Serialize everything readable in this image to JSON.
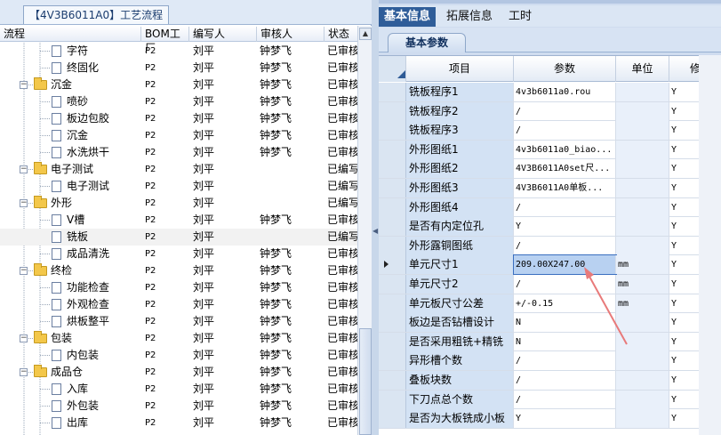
{
  "left_title": "【4V3B6011A0】工艺流程",
  "tree_columns": [
    "流程",
    "BOM工厂",
    "编写人",
    "审核人",
    "状态"
  ],
  "tree_rows": [
    {
      "level": 2,
      "type": "doc",
      "name": "字符",
      "bom": "P2",
      "writer": "刘平",
      "reviewer": "钟梦飞",
      "status": "已审核"
    },
    {
      "level": 2,
      "type": "doc",
      "name": "终固化",
      "bom": "P2",
      "writer": "刘平",
      "reviewer": "钟梦飞",
      "status": "已审核"
    },
    {
      "level": 1,
      "type": "folder",
      "name": "沉金",
      "bom": "P2",
      "writer": "刘平",
      "reviewer": "钟梦飞",
      "status": "已审核"
    },
    {
      "level": 2,
      "type": "doc",
      "name": "喷砂",
      "bom": "P2",
      "writer": "刘平",
      "reviewer": "钟梦飞",
      "status": "已审核"
    },
    {
      "level": 2,
      "type": "doc",
      "name": "板边包胶",
      "bom": "P2",
      "writer": "刘平",
      "reviewer": "钟梦飞",
      "status": "已审核"
    },
    {
      "level": 2,
      "type": "doc",
      "name": "沉金",
      "bom": "P2",
      "writer": "刘平",
      "reviewer": "钟梦飞",
      "status": "已审核"
    },
    {
      "level": 2,
      "type": "doc",
      "name": "水洗烘干",
      "bom": "P2",
      "writer": "刘平",
      "reviewer": "钟梦飞",
      "status": "已审核"
    },
    {
      "level": 1,
      "type": "folder",
      "name": "电子测试",
      "bom": "P2",
      "writer": "刘平",
      "reviewer": "",
      "status": "已编写"
    },
    {
      "level": 2,
      "type": "doc",
      "name": "电子测试",
      "bom": "P2",
      "writer": "刘平",
      "reviewer": "",
      "status": "已编写"
    },
    {
      "level": 1,
      "type": "folder",
      "name": "外形",
      "bom": "P2",
      "writer": "刘平",
      "reviewer": "",
      "status": "已编写"
    },
    {
      "level": 2,
      "type": "doc",
      "name": "V槽",
      "bom": "P2",
      "writer": "刘平",
      "reviewer": "钟梦飞",
      "status": "已审核"
    },
    {
      "level": 2,
      "type": "doc",
      "name": "铣板",
      "bom": "P2",
      "writer": "刘平",
      "reviewer": "",
      "status": "已编写",
      "selected": true
    },
    {
      "level": 2,
      "type": "doc",
      "name": "成品清洗",
      "bom": "P2",
      "writer": "刘平",
      "reviewer": "钟梦飞",
      "status": "已审核"
    },
    {
      "level": 1,
      "type": "folder",
      "name": "终检",
      "bom": "P2",
      "writer": "刘平",
      "reviewer": "钟梦飞",
      "status": "已审核"
    },
    {
      "level": 2,
      "type": "doc",
      "name": "功能检查",
      "bom": "P2",
      "writer": "刘平",
      "reviewer": "钟梦飞",
      "status": "已审核"
    },
    {
      "level": 2,
      "type": "doc",
      "name": "外观检查",
      "bom": "P2",
      "writer": "刘平",
      "reviewer": "钟梦飞",
      "status": "已审核"
    },
    {
      "level": 2,
      "type": "doc",
      "name": "烘板整平",
      "bom": "P2",
      "writer": "刘平",
      "reviewer": "钟梦飞",
      "status": "已审核"
    },
    {
      "level": 1,
      "type": "folder",
      "name": "包装",
      "bom": "P2",
      "writer": "刘平",
      "reviewer": "钟梦飞",
      "status": "已审核"
    },
    {
      "level": 2,
      "type": "doc",
      "name": "内包装",
      "bom": "P2",
      "writer": "刘平",
      "reviewer": "钟梦飞",
      "status": "已审核"
    },
    {
      "level": 1,
      "type": "folder",
      "name": "成品仓",
      "bom": "P2",
      "writer": "刘平",
      "reviewer": "钟梦飞",
      "status": "已审核"
    },
    {
      "level": 2,
      "type": "doc",
      "name": "入库",
      "bom": "P2",
      "writer": "刘平",
      "reviewer": "钟梦飞",
      "status": "已审核"
    },
    {
      "level": 2,
      "type": "doc",
      "name": "外包装",
      "bom": "P2",
      "writer": "刘平",
      "reviewer": "钟梦飞",
      "status": "已审核"
    },
    {
      "level": 2,
      "type": "doc",
      "name": "出库",
      "bom": "P2",
      "writer": "刘平",
      "reviewer": "钟梦飞",
      "status": "已审核"
    }
  ],
  "tabs": [
    "基本信息",
    "拓展信息",
    "工时"
  ],
  "subtab": "基本参数",
  "grid_columns": [
    "项目",
    "参数",
    "单位",
    "修"
  ],
  "grid_rows": [
    {
      "name": "铣板程序1",
      "value": "4v3b6011a0.rou",
      "unit": "",
      "mod": "Y"
    },
    {
      "name": "铣板程序2",
      "value": "/",
      "unit": "",
      "mod": "Y"
    },
    {
      "name": "铣板程序3",
      "value": "/",
      "unit": "",
      "mod": "Y"
    },
    {
      "name": "外形图纸1",
      "value": "4v3b6011a0_biao...",
      "unit": "",
      "mod": "Y"
    },
    {
      "name": "外形图纸2",
      "value": "4V3B6011A0set尺...",
      "unit": "",
      "mod": "Y"
    },
    {
      "name": "外形图纸3",
      "value": "4V3B6011A0单板...",
      "unit": "",
      "mod": "Y"
    },
    {
      "name": "外形图纸4",
      "value": "/",
      "unit": "",
      "mod": "Y"
    },
    {
      "name": "是否有内定位孔",
      "value": "Y",
      "unit": "",
      "mod": "Y"
    },
    {
      "name": "外形露铜图纸",
      "value": "/",
      "unit": "",
      "mod": "Y"
    },
    {
      "name": "单元尺寸1",
      "value": "209.00X247.00",
      "unit": "mm",
      "mod": "Y",
      "selected": true
    },
    {
      "name": "单元尺寸2",
      "value": "/",
      "unit": "mm",
      "mod": "Y"
    },
    {
      "name": "单元板尺寸公差",
      "value": "+/-0.15",
      "unit": "mm",
      "mod": "Y"
    },
    {
      "name": "板边是否钻槽设计",
      "value": "N",
      "unit": "",
      "mod": "Y"
    },
    {
      "name": "是否采用粗铣+精铣",
      "value": "N",
      "unit": "",
      "mod": "Y"
    },
    {
      "name": "异形槽个数",
      "value": "/",
      "unit": "",
      "mod": "Y"
    },
    {
      "name": "叠板块数",
      "value": "/",
      "unit": "",
      "mod": "Y"
    },
    {
      "name": "下刀点总个数",
      "value": "/",
      "unit": "",
      "mod": "Y"
    },
    {
      "name": "是否为大板铣成小板",
      "value": "Y",
      "unit": "",
      "mod": "Y"
    }
  ],
  "colors": {
    "tab_active": "#2f5d99",
    "name_cell": "#d3e2f4",
    "arrow": "#e87a7a"
  }
}
